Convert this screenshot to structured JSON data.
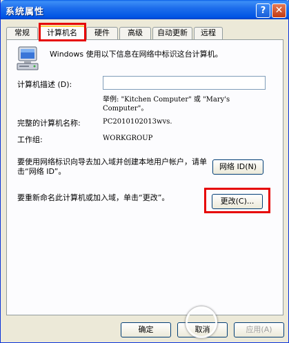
{
  "window": {
    "title": "系统属性",
    "help_label": "?",
    "close_label": "✕"
  },
  "tabs": [
    {
      "label": "常规"
    },
    {
      "label": "计算机名"
    },
    {
      "label": "硬件"
    },
    {
      "label": "高级"
    },
    {
      "label": "自动更新"
    },
    {
      "label": "远程"
    }
  ],
  "panel": {
    "intro_text": "Windows 使用以下信息在网络中标识这台计算机。",
    "description_label": "计算机描述 (D):",
    "description_value": "",
    "example_text": "举例: \"Kitchen Computer\" 或 \"Mary's Computer\"。",
    "full_name_label": "完整的计算机名称:",
    "full_name_value": "PC2010102013wvs.",
    "workgroup_label": "工作组:",
    "workgroup_value": "WORKGROUP",
    "network_id_text": "要使用网络标识向导去加入域并创建本地用户帐户，请单击“网络 ID”。",
    "network_id_button": "网络 ID(N)",
    "rename_text": "要重新命名此计算机或加入域，单击“更改”。",
    "change_button": "更改(C)..."
  },
  "footer": {
    "ok_button": "确定",
    "cancel_button": "取消",
    "apply_button": "应用(A)"
  },
  "colors": {
    "highlight": "#e60000",
    "titlebar": "#0055e5"
  }
}
